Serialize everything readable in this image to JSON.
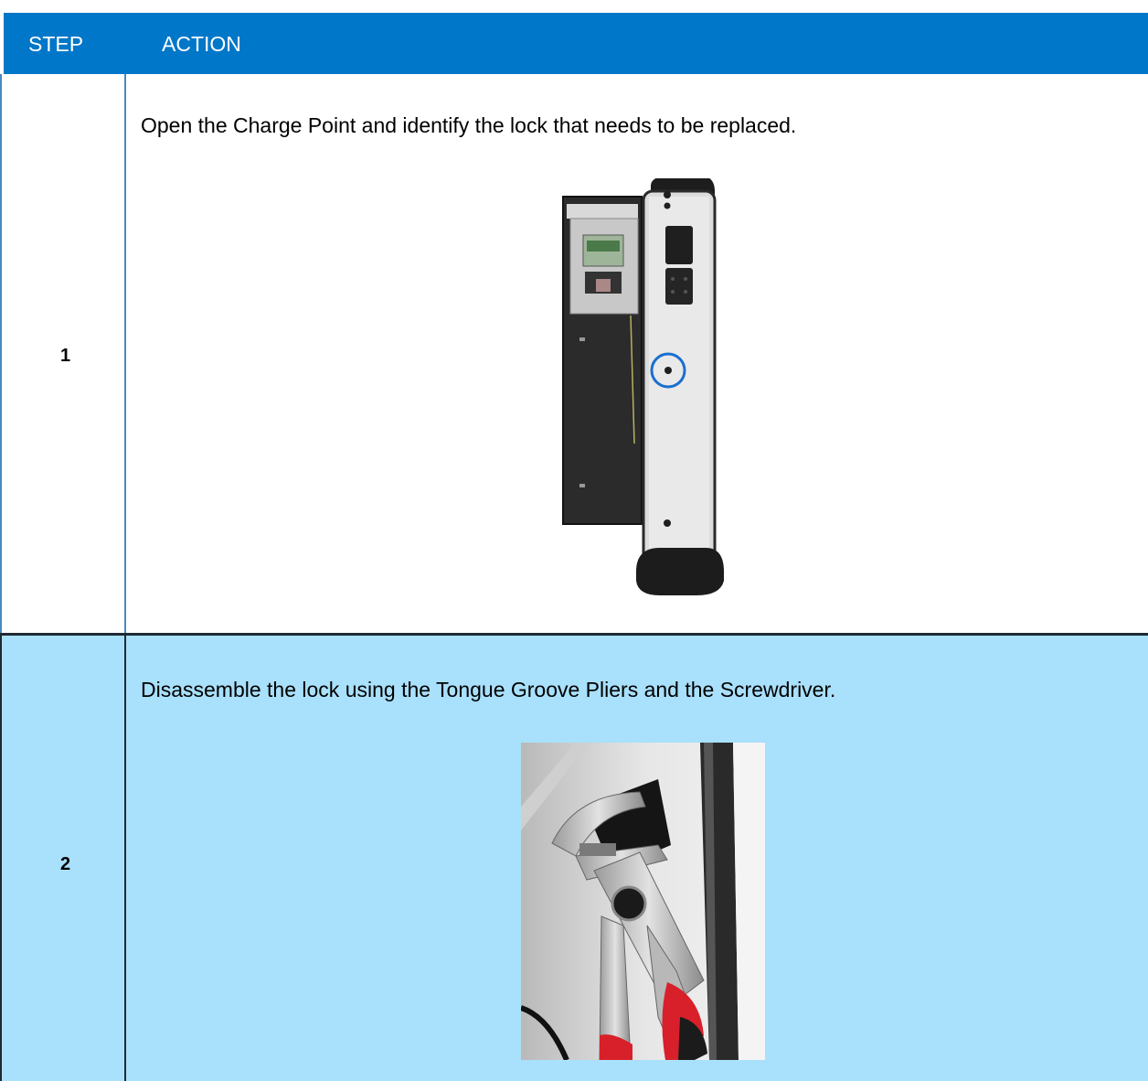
{
  "table": {
    "header": {
      "step": "STEP",
      "action": "ACTION"
    },
    "rows": [
      {
        "step": "1",
        "action": "Open the Charge Point and identify the lock that needs to be replaced.",
        "image": "charge-point-open-illustration"
      },
      {
        "step": "2",
        "action": "Disassemble the lock using the Tongue Groove Pliers and the Screwdriver.",
        "image": "pliers-on-lock-illustration"
      }
    ]
  },
  "colors": {
    "header_bg": "#0077c8",
    "row2_bg": "#a9e0fb",
    "highlight_circle": "#1a6fd0",
    "plier_handle": "#d8202a"
  }
}
